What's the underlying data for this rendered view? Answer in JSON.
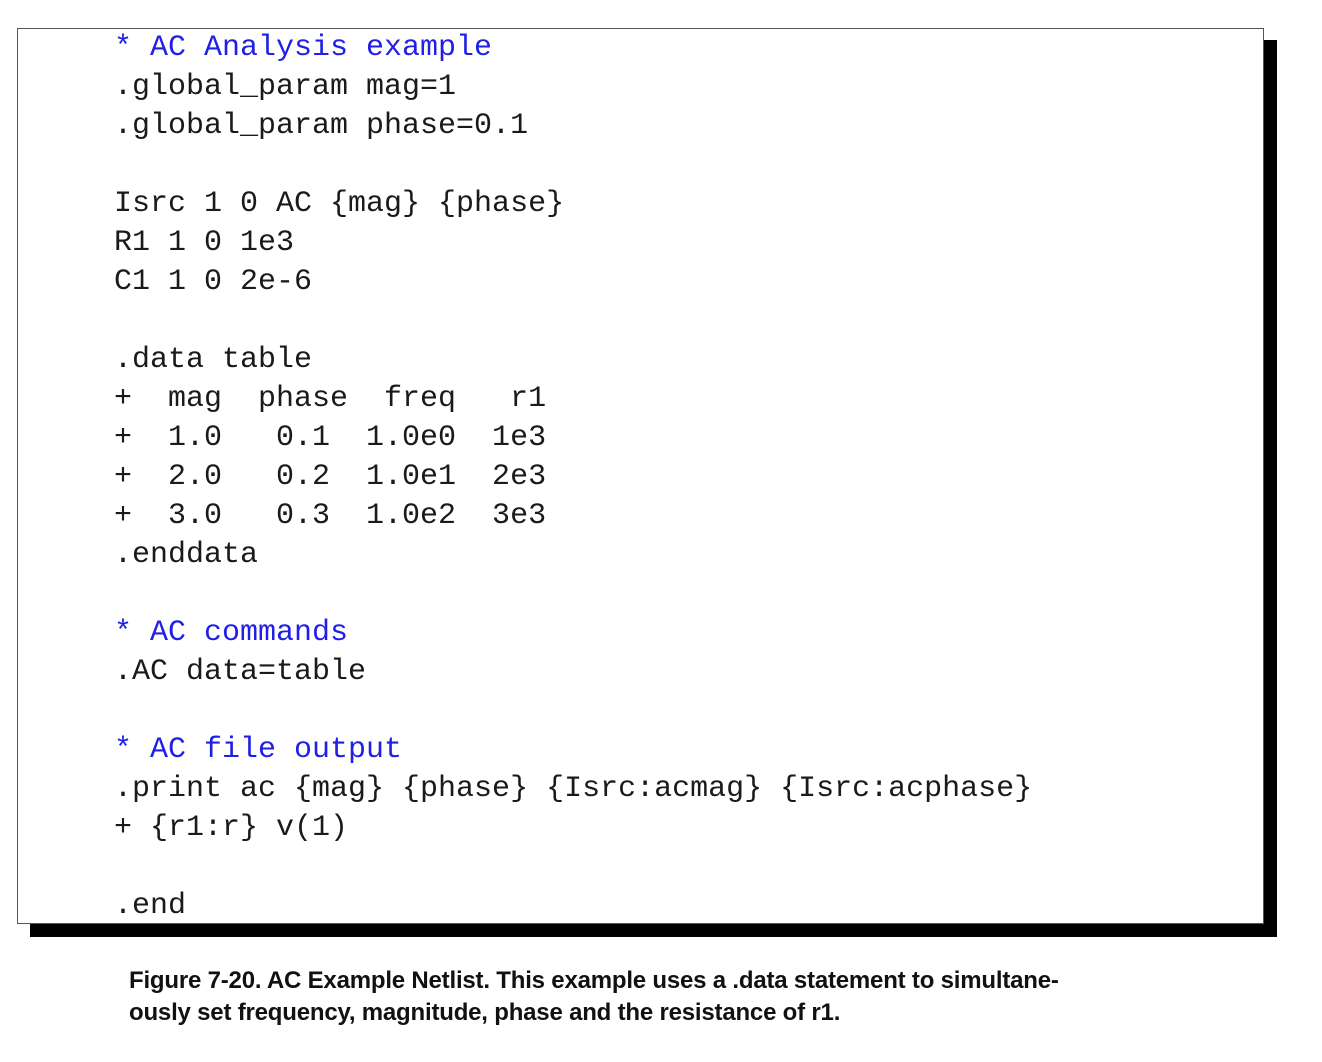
{
  "netlist": {
    "lines": [
      {
        "text": "* AC Analysis example",
        "kind": "comment"
      },
      {
        "text": ".global_param mag=1",
        "kind": "code"
      },
      {
        "text": ".global_param phase=0.1",
        "kind": "code"
      },
      {
        "text": "",
        "kind": "blank"
      },
      {
        "text": "Isrc 1 0 AC {mag} {phase}",
        "kind": "code"
      },
      {
        "text": "R1 1 0 1e3",
        "kind": "code"
      },
      {
        "text": "C1 1 0 2e-6",
        "kind": "code"
      },
      {
        "text": "",
        "kind": "blank"
      },
      {
        "text": ".data table",
        "kind": "code"
      },
      {
        "text": "+  mag  phase  freq   r1",
        "kind": "code"
      },
      {
        "text": "+  1.0   0.1  1.0e0  1e3",
        "kind": "code"
      },
      {
        "text": "+  2.0   0.2  1.0e1  2e3",
        "kind": "code"
      },
      {
        "text": "+  3.0   0.3  1.0e2  3e3",
        "kind": "code"
      },
      {
        "text": ".enddata",
        "kind": "code"
      },
      {
        "text": "",
        "kind": "blank"
      },
      {
        "text": "* AC commands",
        "kind": "comment"
      },
      {
        "text": ".AC data=table",
        "kind": "code"
      },
      {
        "text": "",
        "kind": "blank"
      },
      {
        "text": "* AC file output",
        "kind": "comment"
      },
      {
        "text": ".print ac {mag} {phase} {Isrc:acmag} {Isrc:acphase}",
        "kind": "code"
      },
      {
        "text": "+ {r1:r} v(1)",
        "kind": "code"
      },
      {
        "text": "",
        "kind": "blank"
      },
      {
        "text": ".end",
        "kind": "code"
      }
    ]
  },
  "caption": {
    "line1": "Figure 7-20. AC Example Netlist. This example uses a .data statement to simultane-",
    "line2": "ously set frequency, magnitude, phase and the resistance of r1."
  },
  "colors": {
    "comment": "#1f1fe6",
    "code": "#1a1a1a",
    "shadow": "#000000"
  }
}
